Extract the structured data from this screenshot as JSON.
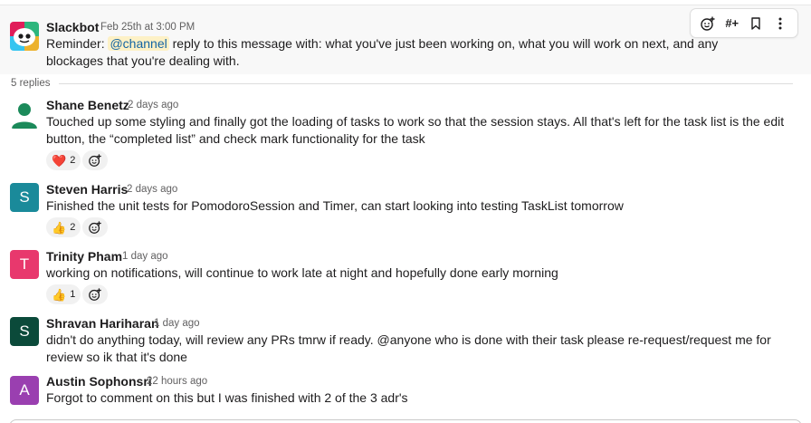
{
  "thread": {
    "parent": {
      "author": "Slackbot",
      "time": "Feb 25th at 3:00 PM",
      "text_prefix": "Reminder: ",
      "mention": "@channel",
      "text_suffix": " reply to this message with: what you've just been working on, what you will work on next, and any blockages that you're dealing with."
    },
    "replies_label": "5 replies",
    "toolbar": {
      "icons": [
        "add-reaction-icon",
        "add-to-channel-icon",
        "bookmark-icon",
        "more-actions-icon"
      ],
      "channel_glyph": "#+"
    },
    "replies": [
      {
        "author": "Shane Benetz",
        "time": "2 days ago",
        "text": "Touched up some styling and finally got the loading of tasks to work so that the session stays. All that's left for the task list is the edit button, the “completed list” and check mark functionality for the task",
        "avatar": {
          "kind": "person-silhouette",
          "color": "#1b8a5a"
        },
        "reaction": {
          "emoji": "❤️",
          "count": "2"
        }
      },
      {
        "author": "Steven Harris",
        "time": "2 days ago",
        "text": "Finished the unit tests for PomodoroSession and Timer, can start looking into testing TaskList tomorrow",
        "avatar": {
          "letter": "S",
          "color": "#1a8a9a"
        },
        "reaction": {
          "emoji": "👍",
          "count": "2"
        }
      },
      {
        "author": "Trinity Pham",
        "time": "1 day ago",
        "text": "working on notifications, will continue to work late at night and hopefully done early morning",
        "avatar": {
          "letter": "T",
          "color": "#e8386d"
        },
        "reaction": {
          "emoji": "👍",
          "count": "1"
        }
      },
      {
        "author": "Shravan Hariharan",
        "time": "1 day ago",
        "text": "didn't do anything today, will review any PRs tmrw if ready. @anyone who is done with their task please re-request/request me for review so ik that it's done",
        "avatar": {
          "letter": "S",
          "color": "#0b4a3a"
        }
      },
      {
        "author": "Austin Sophonsri",
        "time": "22 hours ago",
        "text": "Forgot to comment on this but I was finished with 2 of the 3 adr's",
        "avatar": {
          "letter": "A",
          "color": "#9a3fb0"
        }
      }
    ]
  }
}
